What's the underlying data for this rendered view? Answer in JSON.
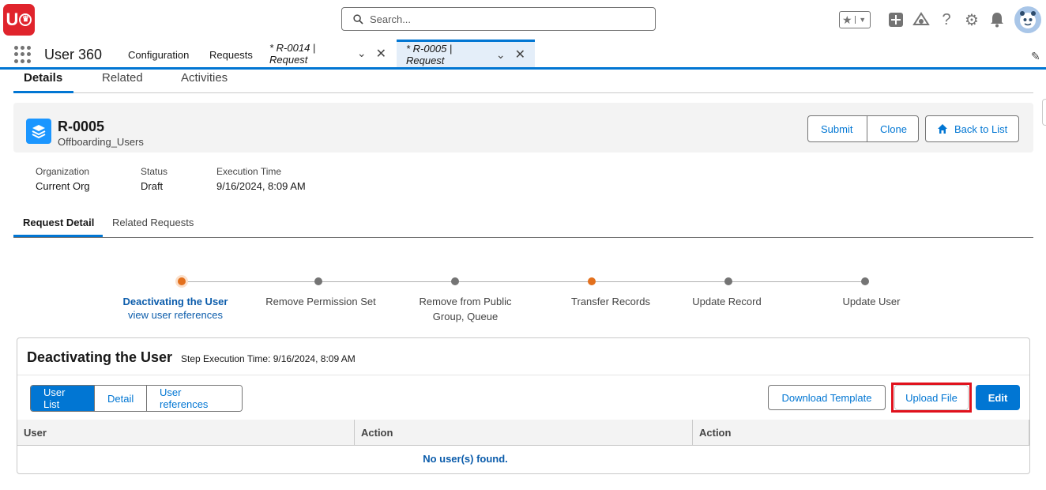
{
  "header": {
    "search_placeholder": "Search...",
    "icons": [
      "star-icon",
      "chevron-down-icon",
      "add-icon",
      "trailhead-icon",
      "help-icon",
      "setup-gear-icon",
      "bell-icon",
      "avatar"
    ]
  },
  "nav": {
    "app_name": "User 360",
    "items": [
      "Configuration",
      "Requests"
    ],
    "tabs": [
      {
        "label": "* R-0014 | Request",
        "active": false
      },
      {
        "label": "* R-0005 | Request",
        "active": true
      }
    ]
  },
  "record_tabs": [
    "Details",
    "Related",
    "Activities"
  ],
  "record": {
    "title": "R-0005",
    "subtitle": "Offboarding_Users",
    "buttons": {
      "submit": "Submit",
      "clone": "Clone",
      "back": "Back to List"
    },
    "fields": [
      {
        "label": "Organization",
        "value": "Current Org"
      },
      {
        "label": "Status",
        "value": "Draft"
      },
      {
        "label": "Execution Time",
        "value": "9/16/2024, 8:09 AM"
      }
    ]
  },
  "sub_tabs": [
    "Request Detail",
    "Related Requests"
  ],
  "path": {
    "steps": [
      {
        "label": "Deactivating the User",
        "link": "view user references",
        "state": "current"
      },
      {
        "label": "Remove Permission Set",
        "state": "pending"
      },
      {
        "label": "Remove from Public Group, Queue",
        "state": "pending"
      },
      {
        "label": "Transfer Records",
        "state": "warning"
      },
      {
        "label": "Update Record",
        "state": "pending"
      },
      {
        "label": "Update User",
        "state": "pending"
      }
    ],
    "colors": {
      "current": "#e3701d",
      "pending": "#747474",
      "link": "#0b5cab"
    }
  },
  "step": {
    "title": "Deactivating the User",
    "execution_time": "Step Execution Time: 9/16/2024, 8:09 AM",
    "view_tabs": [
      "User List",
      "Detail",
      "User references"
    ],
    "actions": {
      "download": "Download Template",
      "upload": "Upload File",
      "edit": "Edit"
    },
    "columns": [
      "User",
      "Action",
      "Action"
    ],
    "empty_message": "No user(s) found."
  },
  "colors": {
    "brand": "#0176d3",
    "highlight": "#e0111c",
    "logo": "#e0242c"
  }
}
